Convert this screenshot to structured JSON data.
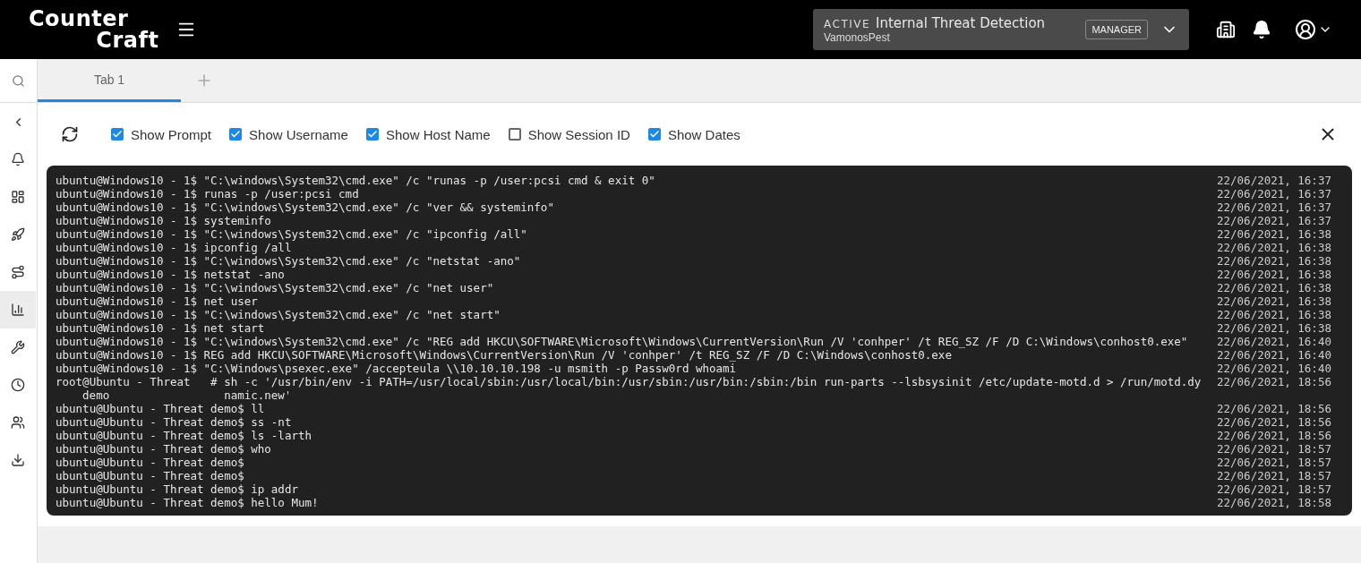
{
  "header": {
    "logo": {
      "line_1": "Counter",
      "line_2": "Craft"
    },
    "project": {
      "status": "ACTIVE",
      "name": "Internal Threat Detection",
      "client": "VamonosPest",
      "role": "MANAGER"
    }
  },
  "sidebar": {
    "items": [
      {
        "selected": false
      },
      {
        "selected": false
      },
      {
        "selected": false
      },
      {
        "selected": false
      },
      {
        "selected": false
      },
      {
        "selected": true
      },
      {
        "selected": false
      },
      {
        "selected": false
      },
      {
        "selected": false
      },
      {
        "selected": false
      }
    ]
  },
  "tabs": [
    {
      "label": "Tab 1",
      "selected": true
    }
  ],
  "options": [
    {
      "label": "Show Prompt",
      "checked": true
    },
    {
      "label": "Show Username",
      "checked": true
    },
    {
      "label": "Show Host Name",
      "checked": true
    },
    {
      "label": "Show Session ID",
      "checked": false
    },
    {
      "label": "Show Dates",
      "checked": true
    }
  ],
  "terminal": {
    "rows": [
      {
        "kind": "line",
        "prompt": "ubuntu@Windows10 - 1$",
        "command": "\"C:\\windows\\System32\\cmd.exe\" /c \"runas -p /user:pcsi cmd & exit 0\"",
        "date": "22/06/2021, 16:37"
      },
      {
        "kind": "line",
        "prompt": "ubuntu@Windows10 - 1$",
        "command": "runas -p /user:pcsi cmd",
        "date": "22/06/2021, 16:37"
      },
      {
        "kind": "line",
        "prompt": "ubuntu@Windows10 - 1$",
        "command": "\"C:\\windows\\System32\\cmd.exe\" /c \"ver && systeminfo\"",
        "date": "22/06/2021, 16:37"
      },
      {
        "kind": "line",
        "prompt": "ubuntu@Windows10 - 1$",
        "command": "systeminfo",
        "date": "22/06/2021, 16:37"
      },
      {
        "kind": "line",
        "prompt": "ubuntu@Windows10 - 1$",
        "command": "\"C:\\windows\\System32\\cmd.exe\" /c \"ipconfig /all\"",
        "date": "22/06/2021, 16:38"
      },
      {
        "kind": "line",
        "prompt": "ubuntu@Windows10 - 1$",
        "command": "ipconfig /all",
        "date": "22/06/2021, 16:38"
      },
      {
        "kind": "line",
        "prompt": "ubuntu@Windows10 - 1$",
        "command": "\"C:\\windows\\System32\\cmd.exe\" /c \"netstat -ano\"",
        "date": "22/06/2021, 16:38"
      },
      {
        "kind": "line",
        "prompt": "ubuntu@Windows10 - 1$",
        "command": "netstat -ano",
        "date": "22/06/2021, 16:38"
      },
      {
        "kind": "line",
        "prompt": "ubuntu@Windows10 - 1$",
        "command": "\"C:\\windows\\System32\\cmd.exe\" /c \"net user\"",
        "date": "22/06/2021, 16:38"
      },
      {
        "kind": "line",
        "prompt": "ubuntu@Windows10 - 1$",
        "command": "net user",
        "date": "22/06/2021, 16:38"
      },
      {
        "kind": "line",
        "prompt": "ubuntu@Windows10 - 1$",
        "command": "\"C:\\windows\\System32\\cmd.exe\" /c \"net start\"",
        "date": "22/06/2021, 16:38"
      },
      {
        "kind": "line",
        "prompt": "ubuntu@Windows10 - 1$",
        "command": "net start",
        "date": "22/06/2021, 16:38"
      },
      {
        "kind": "line",
        "prompt": "ubuntu@Windows10 - 1$",
        "command": "\"C:\\windows\\System32\\cmd.exe\" /c \"REG add HKCU\\SOFTWARE\\Microsoft\\Windows\\CurrentVersion\\Run /V 'conhper' /t REG_SZ /F /D C:\\Windows\\conhost0.exe\"",
        "date": "22/06/2021, 16:40"
      },
      {
        "kind": "line",
        "prompt": "ubuntu@Windows10 - 1$",
        "command": "REG add HKCU\\SOFTWARE\\Microsoft\\Windows\\CurrentVersion\\Run /V 'conhper' /t REG_SZ /F /D C:\\Windows\\conhost0.exe",
        "date": "22/06/2021, 16:40"
      },
      {
        "kind": "line",
        "prompt": "ubuntu@Windows10 - 1$",
        "command": "\"C:\\Windows\\psexec.exe\" /accepteula \\\\10.10.10.198 -u msmith -p Passw0rd whoami",
        "date": "22/06/2021, 16:40"
      },
      {
        "kind": "wrapped",
        "prompt": "root@Ubuntu - Threat demo",
        "symbol": "#",
        "command": "sh -c '/usr/bin/env -i PATH=/usr/local/sbin:/usr/local/bin:/usr/sbin:/usr/bin:/sbin:/bin run-parts --lsbsysinit /etc/update-motd.d > /run/motd.dynamic.new'",
        "date": "22/06/2021, 18:56"
      },
      {
        "kind": "line",
        "prompt": "ubuntu@Ubuntu - Threat demo$",
        "command": "ll",
        "date": "22/06/2021, 18:56"
      },
      {
        "kind": "line",
        "prompt": "ubuntu@Ubuntu - Threat demo$",
        "command": "ss -nt",
        "date": "22/06/2021, 18:56"
      },
      {
        "kind": "line",
        "prompt": "ubuntu@Ubuntu - Threat demo$",
        "command": "ls -larth",
        "date": "22/06/2021, 18:56"
      },
      {
        "kind": "line",
        "prompt": "ubuntu@Ubuntu - Threat demo$",
        "command": "who",
        "date": "22/06/2021, 18:57"
      },
      {
        "kind": "line",
        "prompt": "ubuntu@Ubuntu - Threat demo$",
        "date": "22/06/2021, 18:57"
      },
      {
        "kind": "line",
        "prompt": "ubuntu@Ubuntu - Threat demo$",
        "date": "22/06/2021, 18:57"
      },
      {
        "kind": "line",
        "prompt": "ubuntu@Ubuntu - Threat demo$",
        "command": "ip addr",
        "date": "22/06/2021, 18:57"
      },
      {
        "kind": "line",
        "prompt": "ubuntu@Ubuntu - Threat demo$",
        "command": "hello Mum!",
        "date": "22/06/2021, 18:58"
      }
    ]
  }
}
